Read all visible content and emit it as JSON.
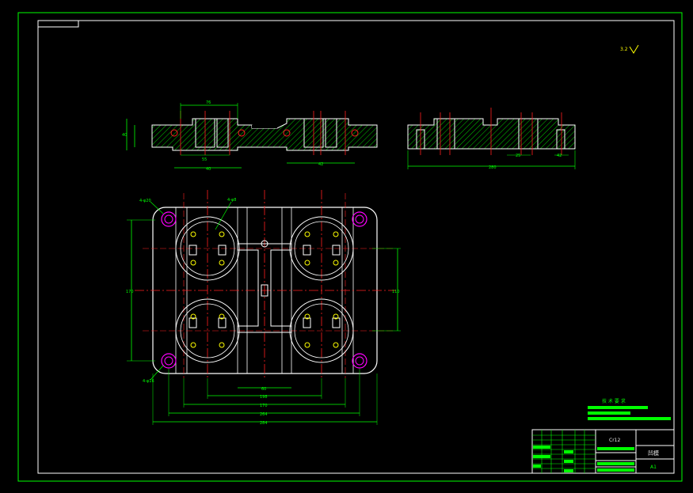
{
  "sheet": {
    "background": "#000000",
    "frame_color": "#00ff00",
    "line_color": "#ffffff",
    "centerline_color": "#ff2020",
    "hole_color": "#ff00ff"
  },
  "surface_note": "3.2",
  "tech_requirements_title": "技 术 要 求",
  "title_block": {
    "material": "Cr12",
    "part_name": "凹模",
    "sheet_size": "A1"
  },
  "dims_top": [
    "76",
    "40",
    "42",
    "55",
    "40"
  ],
  "dims_side": [
    "280",
    "25",
    "42",
    "22"
  ],
  "dims_plan": [
    "170",
    "110",
    "60",
    "198",
    "170",
    "264",
    "284",
    "300"
  ],
  "callouts": [
    "4-φ20",
    "4-φ8",
    "4-φ16"
  ]
}
